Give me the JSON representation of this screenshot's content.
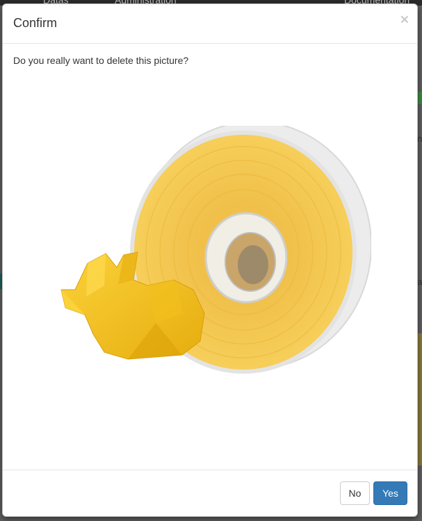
{
  "background_page": {
    "nav_items": [
      "Datas",
      "Administration",
      "Documentation"
    ],
    "edge_fragments": [
      "n",
      "a"
    ]
  },
  "modal": {
    "title": "Confirm",
    "close_symbol": "×",
    "question": "Do you really want to delete this picture?",
    "picture": {
      "icon": "yellow-filament-spool-and-low-poly-bunny-photo",
      "colors": {
        "filament": "#f3c53b",
        "bunny": "#f6c11c",
        "spool_rim": "#e7e7e7"
      }
    },
    "buttons": {
      "no_label": "No",
      "yes_label": "Yes"
    },
    "colors": {
      "primary": "#337ab7",
      "border": "#e5e5e5"
    }
  }
}
